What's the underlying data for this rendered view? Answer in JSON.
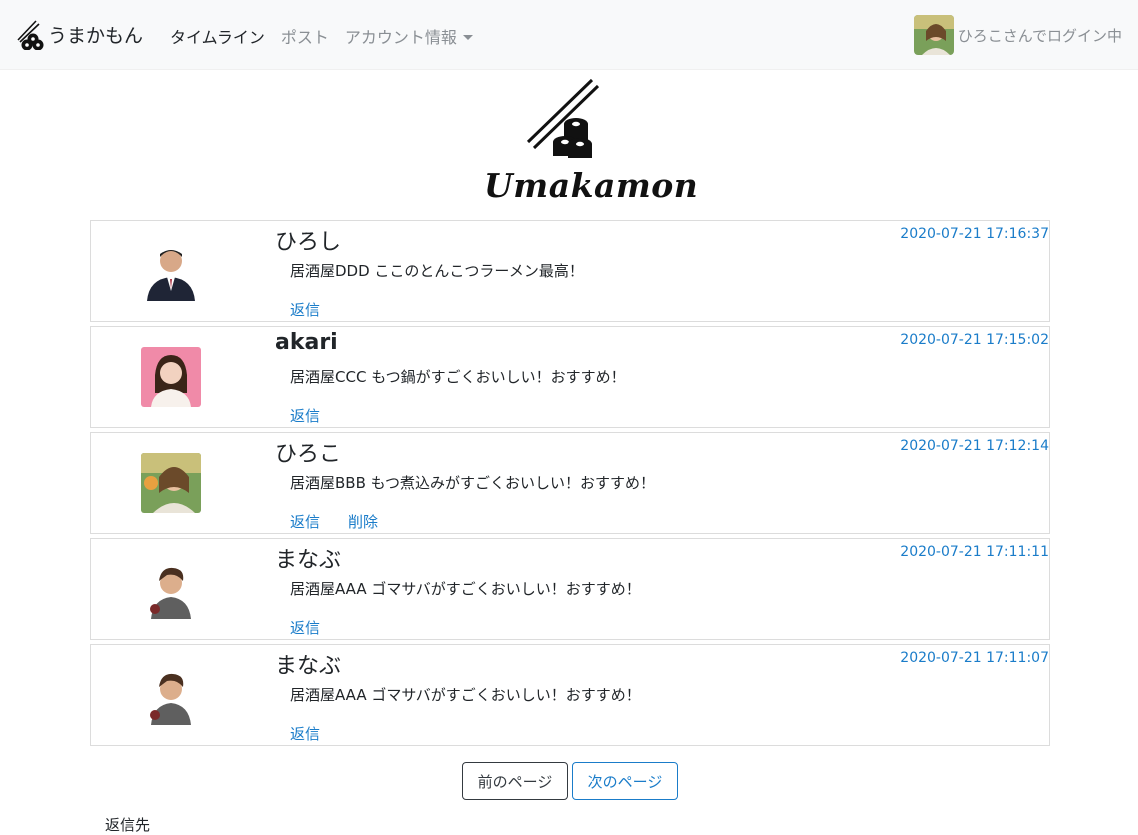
{
  "navbar": {
    "brand": "うまかもん",
    "links": [
      {
        "label": "タイムライン"
      },
      {
        "label": "ポスト"
      },
      {
        "label": "アカウント情報"
      }
    ],
    "login_text": "ひろこさんでログイン中"
  },
  "logo": {
    "text": "Umakamon"
  },
  "posts": [
    {
      "user": "ひろし",
      "time": "2020-07-21 17:16:37",
      "message": "居酒屋DDD ここのとんこつラーメン最高！",
      "reply": "返信"
    },
    {
      "user": "akari",
      "time": "2020-07-21 17:15:02",
      "message": "居酒屋CCC もつ鍋がすごくおいしい！おすすめ！",
      "reply": "返信"
    },
    {
      "user": "ひろこ",
      "time": "2020-07-21 17:12:14",
      "message": "居酒屋BBB もつ煮込みがすごくおいしい！おすすめ！",
      "reply": "返信",
      "delete": "削除"
    },
    {
      "user": "まなぶ",
      "time": "2020-07-21 17:11:11",
      "message": "居酒屋AAA ゴマサバがすごくおいしい！おすすめ！",
      "reply": "返信"
    },
    {
      "user": "まなぶ",
      "time": "2020-07-21 17:11:07",
      "message": "居酒屋AAA ゴマサバがすごくおいしい！おすすめ！",
      "reply": "返信"
    }
  ],
  "pagination": {
    "prev": "前のページ",
    "next": "次のページ"
  },
  "footer": {
    "text": "返信先"
  },
  "colors": {
    "link": "#1a7cc9",
    "navbar_bg": "#f8f9fa",
    "text": "#212529",
    "muted": "#8a8f94"
  }
}
